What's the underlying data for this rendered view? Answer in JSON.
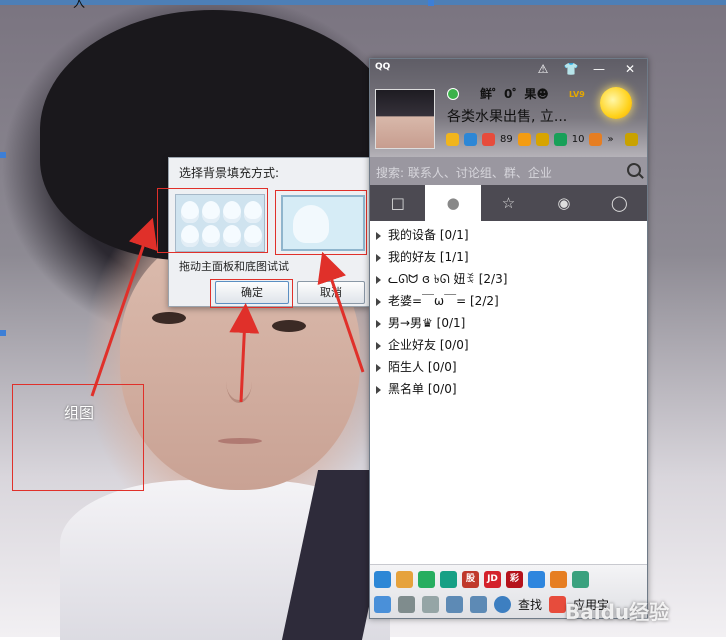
{
  "top_text": "入",
  "annotation_label": "组图",
  "dialog": {
    "title": "选择背景填充方式:",
    "hint": "拖动主面板和底图试试",
    "ok": "确定",
    "cancel": "取消"
  },
  "qq": {
    "logo": "QQ",
    "controls": {
      "shield": "⚠",
      "skin": "👕",
      "minimize": "—",
      "close": "✕"
    },
    "nickname": "鲜゜0゜果☻",
    "level": "LV9",
    "signature": "各类水果出售, 立...",
    "badges": {
      "mail_count": "89",
      "chat_count": "10"
    },
    "search_placeholder": "搜索: 联系人、讨论组、群、企业",
    "tabs": [
      "session",
      "contacts",
      "favorites",
      "groups",
      "space"
    ],
    "groups": [
      {
        "name": "我的设备",
        "count": "[0/1]"
      },
      {
        "name": "我的好友",
        "count": "[1/1]"
      },
      {
        "name": "ᓚᘏᗢ ɞ ৳ᘏ 妞ꉂ",
        "count": "[2/3]"
      },
      {
        "name": "老婆=￣ω￣=",
        "count": "[2/2]"
      },
      {
        "name": "男→男♛",
        "count": "[0/1]"
      },
      {
        "name": "企业好友",
        "count": "[0/0]"
      },
      {
        "name": "陌生人",
        "count": "[0/0]"
      },
      {
        "name": "黑名单",
        "count": "[0/0]"
      }
    ],
    "app_icons": [
      "browser",
      "pet",
      "music",
      "video",
      "股",
      "JD",
      "彩",
      "mail",
      "game",
      "photo"
    ],
    "find_label": "查找",
    "app_store_label": "应用宝"
  },
  "watermark": "Baidu经验",
  "colors": {
    "annotation_red": "#e0302a",
    "tab_bar": "#4c4a52",
    "status_online": "#3bb24a"
  }
}
